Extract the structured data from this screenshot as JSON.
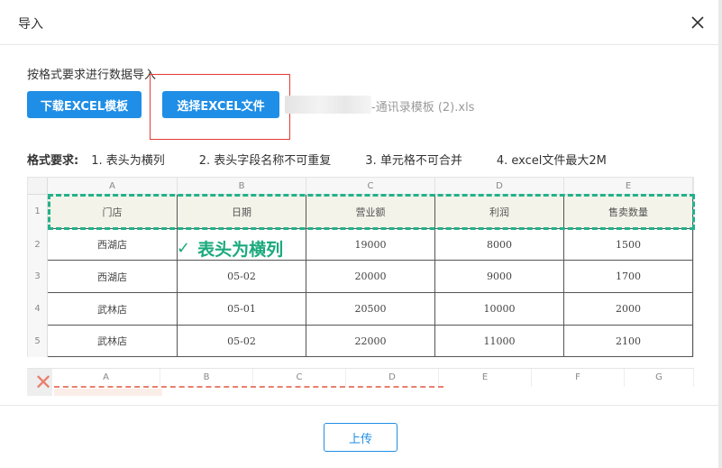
{
  "dialog": {
    "title": "导入"
  },
  "instruction": "按格式要求进行数据导入",
  "buttons": {
    "download": "下载EXCEL模板",
    "select": "选择EXCEL文件",
    "upload": "上传"
  },
  "file_name": "-通讯录模板 (2).xls",
  "format": {
    "label": "格式要求:",
    "items": [
      "1. 表头为横列",
      "2. 表头字段名称不可重复",
      "3. 单元格不可合并",
      "4. excel文件最大2M"
    ]
  },
  "sheet1": {
    "columns": [
      "A",
      "B",
      "C",
      "D",
      "E"
    ],
    "rows": [
      "1",
      "2",
      "3",
      "4",
      "5"
    ],
    "headers": [
      "门店",
      "日期",
      "营业额",
      "利润",
      "售卖数量"
    ],
    "data": [
      [
        "西湖店",
        "",
        "19000",
        "8000",
        "1500"
      ],
      [
        "西湖店",
        "05-02",
        "20000",
        "9000",
        "1700"
      ],
      [
        "武林店",
        "05-01",
        "20500",
        "10000",
        "2000"
      ],
      [
        "武林店",
        "05-02",
        "22000",
        "11000",
        "2100"
      ]
    ],
    "note": "表头为横列"
  },
  "sheet2": {
    "columns": [
      "A",
      "B",
      "C",
      "D",
      "E",
      "F",
      "G"
    ]
  },
  "colors": {
    "primary": "#1f8ee6",
    "ok_green": "#22b28a",
    "error_red": "#e53935"
  }
}
